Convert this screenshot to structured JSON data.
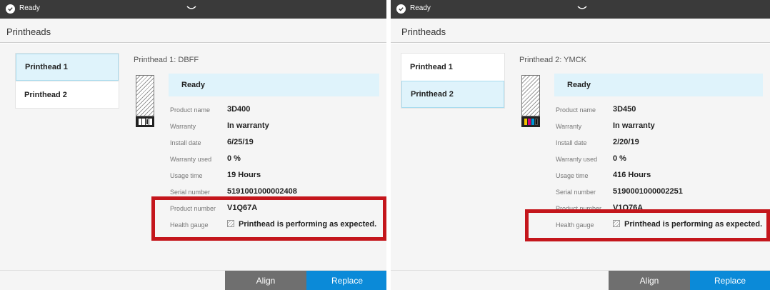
{
  "screens": [
    {
      "status_bar": {
        "status": "Ready"
      },
      "page_title": "Printheads",
      "printhead_list": [
        {
          "label": "Printhead 1",
          "selected": true
        },
        {
          "label": "Printhead 2",
          "selected": false
        }
      ],
      "detail": {
        "header": "Printhead 1: DBFF",
        "status": "Ready",
        "cartridge_colors": [
          "#ffffff",
          "#ffffff",
          "#222222",
          "#ffffff"
        ],
        "properties": [
          {
            "label": "Product name",
            "value": "3D400"
          },
          {
            "label": "Warranty",
            "value": "In warranty"
          },
          {
            "label": "Install date",
            "value": "6/25/19"
          },
          {
            "label": "Warranty used",
            "value": "0 %"
          },
          {
            "label": "Usage time",
            "value": "19 Hours"
          },
          {
            "label": "Serial number",
            "value": "5191001000002408"
          },
          {
            "label": "Product number",
            "value": "V1Q67A"
          },
          {
            "label": "Health gauge",
            "value": "Printhead is performing as expected."
          }
        ]
      },
      "actions": {
        "align": "Align",
        "replace": "Replace"
      }
    },
    {
      "status_bar": {
        "status": "Ready"
      },
      "page_title": "Printheads",
      "printhead_list": [
        {
          "label": "Printhead 1",
          "selected": false
        },
        {
          "label": "Printhead 2",
          "selected": true
        }
      ],
      "detail": {
        "header": "Printhead 2: YMCK",
        "status": "Ready",
        "cartridge_colors": [
          "#f2c200",
          "#d6007a",
          "#0098d8",
          "#111111"
        ],
        "properties": [
          {
            "label": "Product name",
            "value": "3D450"
          },
          {
            "label": "Warranty",
            "value": "In warranty"
          },
          {
            "label": "Install date",
            "value": "2/20/19"
          },
          {
            "label": "Warranty used",
            "value": "0 %"
          },
          {
            "label": "Usage time",
            "value": "416 Hours"
          },
          {
            "label": "Serial number",
            "value": "5190001000002251"
          },
          {
            "label": "Product number",
            "value": "V1Q76A"
          },
          {
            "label": "Health gauge",
            "value": "Printhead is performing as expected."
          }
        ]
      },
      "actions": {
        "align": "Align",
        "replace": "Replace"
      }
    }
  ],
  "colors": {
    "top_bar": "#3a3a3a",
    "selected_bg": "#dff3fb",
    "align_button": "#6f6f6f",
    "replace_button": "#0b8ad8",
    "highlight_box": "#c4161c"
  }
}
